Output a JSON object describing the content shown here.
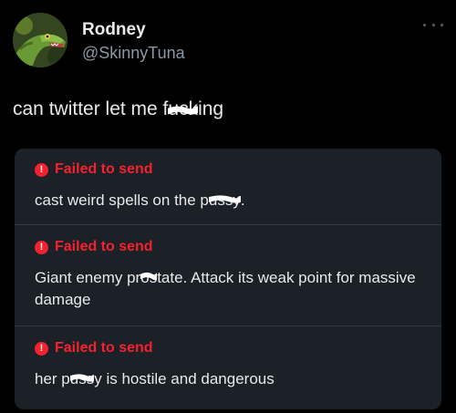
{
  "header": {
    "display_name": "Rodney",
    "handle": "@SkinnyTuna",
    "more_icon": "more-horizontal-icon",
    "avatar_icon": "lizard-avatar"
  },
  "tweet": {
    "text_before": "can twitter let me f",
    "text_censored": "uck",
    "text_after": "ing"
  },
  "drafts": [
    {
      "status": "Failed to send",
      "text_before": "cast weird spells on the p",
      "text_censored": "ussy",
      "text_after": "."
    },
    {
      "status": "Failed to send",
      "text_before": "Giant enemy pr",
      "text_censored": "os",
      "text_after": "tate. Attack its weak point for massive damage"
    },
    {
      "status": "Failed to send",
      "text_before": "her p",
      "text_censored": "uss",
      "text_after": "y is hostile and dangerous"
    }
  ],
  "colors": {
    "background": "#000000",
    "panel": "#1b2127",
    "error": "#f4212e",
    "text": "#e7e9ea",
    "secondary": "#8b98a5"
  }
}
